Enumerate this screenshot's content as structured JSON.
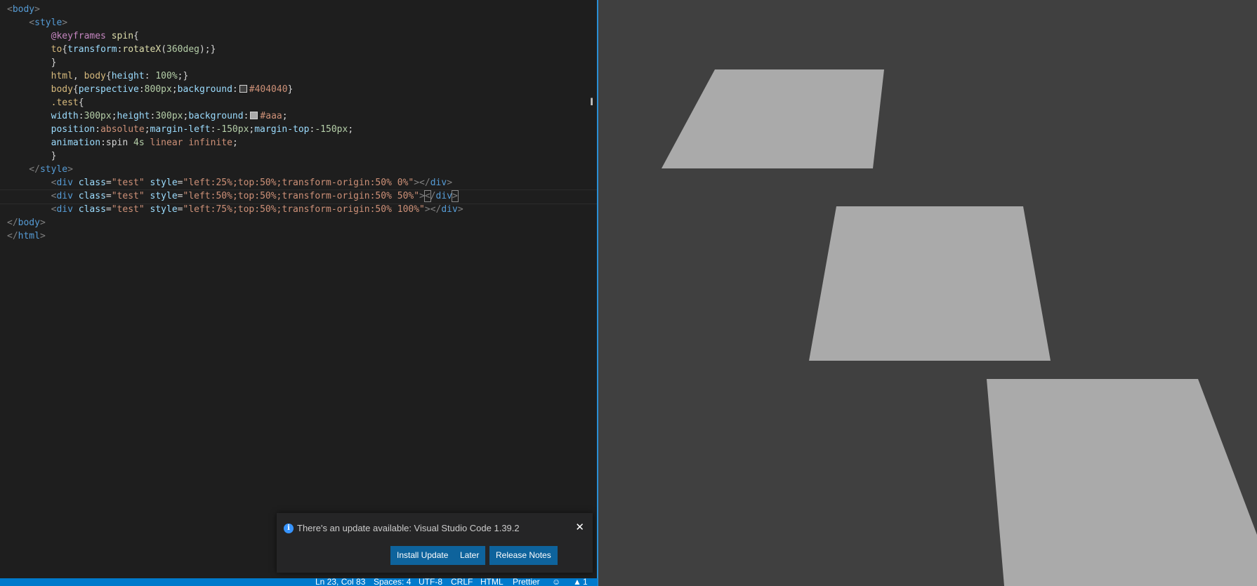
{
  "code_lines": [
    [
      {
        "t": "<",
        "c": "t-punct",
        "i": 0
      },
      {
        "t": "body",
        "c": "t-tag"
      },
      {
        "t": ">",
        "c": "t-punct"
      }
    ],
    [
      {
        "t": "    <",
        "c": "t-punct"
      },
      {
        "t": "style",
        "c": "t-tag"
      },
      {
        "t": ">",
        "c": "t-punct"
      }
    ],
    [
      {
        "t": "        @keyframes",
        "c": "t-kw"
      },
      {
        "t": " ",
        "c": "t-plain"
      },
      {
        "t": "spin",
        "c": "t-fn"
      },
      {
        "t": "{",
        "c": "t-plain"
      }
    ],
    [
      {
        "t": "        to",
        "c": "t-sel"
      },
      {
        "t": "{",
        "c": "t-plain"
      },
      {
        "t": "transform",
        "c": "t-prop"
      },
      {
        "t": ":",
        "c": "t-plain"
      },
      {
        "t": "rotateX",
        "c": "t-fn"
      },
      {
        "t": "(",
        "c": "t-plain"
      },
      {
        "t": "360deg",
        "c": "t-num"
      },
      {
        "t": ");}",
        "c": "t-plain"
      }
    ],
    [
      {
        "t": "        }",
        "c": "t-plain"
      }
    ],
    [
      {
        "t": "        html",
        "c": "t-sel"
      },
      {
        "t": ", ",
        "c": "t-plain"
      },
      {
        "t": "body",
        "c": "t-sel"
      },
      {
        "t": "{",
        "c": "t-plain"
      },
      {
        "t": "height",
        "c": "t-prop"
      },
      {
        "t": ": ",
        "c": "t-plain"
      },
      {
        "t": "100%",
        "c": "t-num"
      },
      {
        "t": ";}",
        "c": "t-plain"
      }
    ],
    [
      {
        "t": "        body",
        "c": "t-sel"
      },
      {
        "t": "{",
        "c": "t-plain"
      },
      {
        "t": "perspective",
        "c": "t-prop"
      },
      {
        "t": ":",
        "c": "t-plain"
      },
      {
        "t": "800px",
        "c": "t-num"
      },
      {
        "t": ";",
        "c": "t-plain"
      },
      {
        "t": "background",
        "c": "t-prop"
      },
      {
        "t": ":",
        "c": "t-plain"
      },
      {
        "swatch": "#404040"
      },
      {
        "t": "#404040",
        "c": "t-val"
      },
      {
        "t": "}",
        "c": "t-plain"
      }
    ],
    [
      {
        "t": "        .test",
        "c": "t-sel"
      },
      {
        "t": "{",
        "c": "t-plain"
      }
    ],
    [
      {
        "t": "        width",
        "c": "t-prop"
      },
      {
        "t": ":",
        "c": "t-plain"
      },
      {
        "t": "300px",
        "c": "t-num"
      },
      {
        "t": ";",
        "c": "t-plain"
      },
      {
        "t": "height",
        "c": "t-prop"
      },
      {
        "t": ":",
        "c": "t-plain"
      },
      {
        "t": "300px",
        "c": "t-num"
      },
      {
        "t": ";",
        "c": "t-plain"
      },
      {
        "t": "background",
        "c": "t-prop"
      },
      {
        "t": ":",
        "c": "t-plain"
      },
      {
        "swatch": "#aaaaaa"
      },
      {
        "t": "#aaa",
        "c": "t-val"
      },
      {
        "t": ";",
        "c": "t-plain"
      }
    ],
    [
      {
        "t": "        position",
        "c": "t-prop"
      },
      {
        "t": ":",
        "c": "t-plain"
      },
      {
        "t": "absolute",
        "c": "t-val"
      },
      {
        "t": ";",
        "c": "t-plain"
      },
      {
        "t": "margin-left",
        "c": "t-prop"
      },
      {
        "t": ":",
        "c": "t-plain"
      },
      {
        "t": "-150px",
        "c": "t-num"
      },
      {
        "t": ";",
        "c": "t-plain"
      },
      {
        "t": "margin-top",
        "c": "t-prop"
      },
      {
        "t": ":",
        "c": "t-plain"
      },
      {
        "t": "-150px",
        "c": "t-num"
      },
      {
        "t": ";",
        "c": "t-plain"
      }
    ],
    [
      {
        "t": "        animation",
        "c": "t-prop"
      },
      {
        "t": ":",
        "c": "t-plain"
      },
      {
        "t": "spin ",
        "c": "t-plain"
      },
      {
        "t": "4s",
        "c": "t-num"
      },
      {
        "t": " ",
        "c": "t-plain"
      },
      {
        "t": "linear",
        "c": "t-val"
      },
      {
        "t": " ",
        "c": "t-plain"
      },
      {
        "t": "infinite",
        "c": "t-val"
      },
      {
        "t": ";",
        "c": "t-plain"
      }
    ],
    [
      {
        "t": "        }",
        "c": "t-plain"
      }
    ],
    [
      {
        "t": "    </",
        "c": "t-punct"
      },
      {
        "t": "style",
        "c": "t-tag"
      },
      {
        "t": ">",
        "c": "t-punct"
      }
    ],
    [
      {
        "t": "        <",
        "c": "t-punct"
      },
      {
        "t": "div",
        "c": "t-tag"
      },
      {
        "t": " ",
        "c": "t-plain"
      },
      {
        "t": "class",
        "c": "t-attr"
      },
      {
        "t": "=",
        "c": "t-plain"
      },
      {
        "t": "\"test\"",
        "c": "t-str"
      },
      {
        "t": " ",
        "c": "t-plain"
      },
      {
        "t": "style",
        "c": "t-attr"
      },
      {
        "t": "=",
        "c": "t-plain"
      },
      {
        "t": "\"left:25%;top:50%;transform-origin:50% 0%\"",
        "c": "t-str"
      },
      {
        "t": "></",
        "c": "t-punct"
      },
      {
        "t": "div",
        "c": "t-tag"
      },
      {
        "t": ">",
        "c": "t-punct"
      }
    ],
    [
      {
        "t": "        <",
        "c": "t-punct"
      },
      {
        "t": "div",
        "c": "t-tag"
      },
      {
        "t": " ",
        "c": "t-plain"
      },
      {
        "t": "class",
        "c": "t-attr"
      },
      {
        "t": "=",
        "c": "t-plain"
      },
      {
        "t": "\"test\"",
        "c": "t-str"
      },
      {
        "t": " ",
        "c": "t-plain"
      },
      {
        "t": "style",
        "c": "t-attr"
      },
      {
        "t": "=",
        "c": "t-plain"
      },
      {
        "t": "\"left:50%;top:50%;transform-origin:50% 50%\"",
        "c": "t-str"
      },
      {
        "t": ">",
        "c": "t-punct"
      },
      {
        "t": "<",
        "c": "t-punct",
        "hl": true
      },
      {
        "t": "/",
        "c": "t-punct"
      },
      {
        "t": "div",
        "c": "t-tag"
      },
      {
        "t": ">",
        "c": "t-punct",
        "hl": true
      }
    ],
    [
      {
        "t": "        <",
        "c": "t-punct"
      },
      {
        "t": "div",
        "c": "t-tag"
      },
      {
        "t": " ",
        "c": "t-plain"
      },
      {
        "t": "class",
        "c": "t-attr"
      },
      {
        "t": "=",
        "c": "t-plain"
      },
      {
        "t": "\"test\"",
        "c": "t-str"
      },
      {
        "t": " ",
        "c": "t-plain"
      },
      {
        "t": "style",
        "c": "t-attr"
      },
      {
        "t": "=",
        "c": "t-plain"
      },
      {
        "t": "\"left:75%;top:50%;transform-origin:50% 100%\"",
        "c": "t-str"
      },
      {
        "t": "></",
        "c": "t-punct"
      },
      {
        "t": "div",
        "c": "t-tag"
      },
      {
        "t": ">",
        "c": "t-punct"
      }
    ],
    [
      {
        "t": "</",
        "c": "t-punct"
      },
      {
        "t": "body",
        "c": "t-tag"
      },
      {
        "t": ">",
        "c": "t-punct"
      }
    ],
    [
      {
        "t": "</",
        "c": "t-punct"
      },
      {
        "t": "html",
        "c": "t-tag"
      },
      {
        "t": ">",
        "c": "t-punct"
      }
    ]
  ],
  "current_line_index": 14,
  "preview": {
    "background": "#404040",
    "tile_color": "#aaaaaa"
  },
  "notification": {
    "icon": "info-icon",
    "message": "There's an update available: Visual Studio Code 1.39.2",
    "close_icon": "close-icon",
    "buttons": {
      "install": "Install Update",
      "later": "Later",
      "release_notes": "Release Notes"
    }
  },
  "statusbar": {
    "position": "Ln 23, Col 83",
    "spaces": "Spaces: 4",
    "encoding": "UTF-8",
    "eol": "CRLF",
    "language": "HTML",
    "formatter": "Prettier",
    "feedback_icon": "smiley-icon",
    "bell_icon": "bell-icon",
    "notifications_count": "1"
  },
  "colors": {
    "accent": "#007acc",
    "button": "#0e639c",
    "editor_bg": "#1e1e1e"
  }
}
